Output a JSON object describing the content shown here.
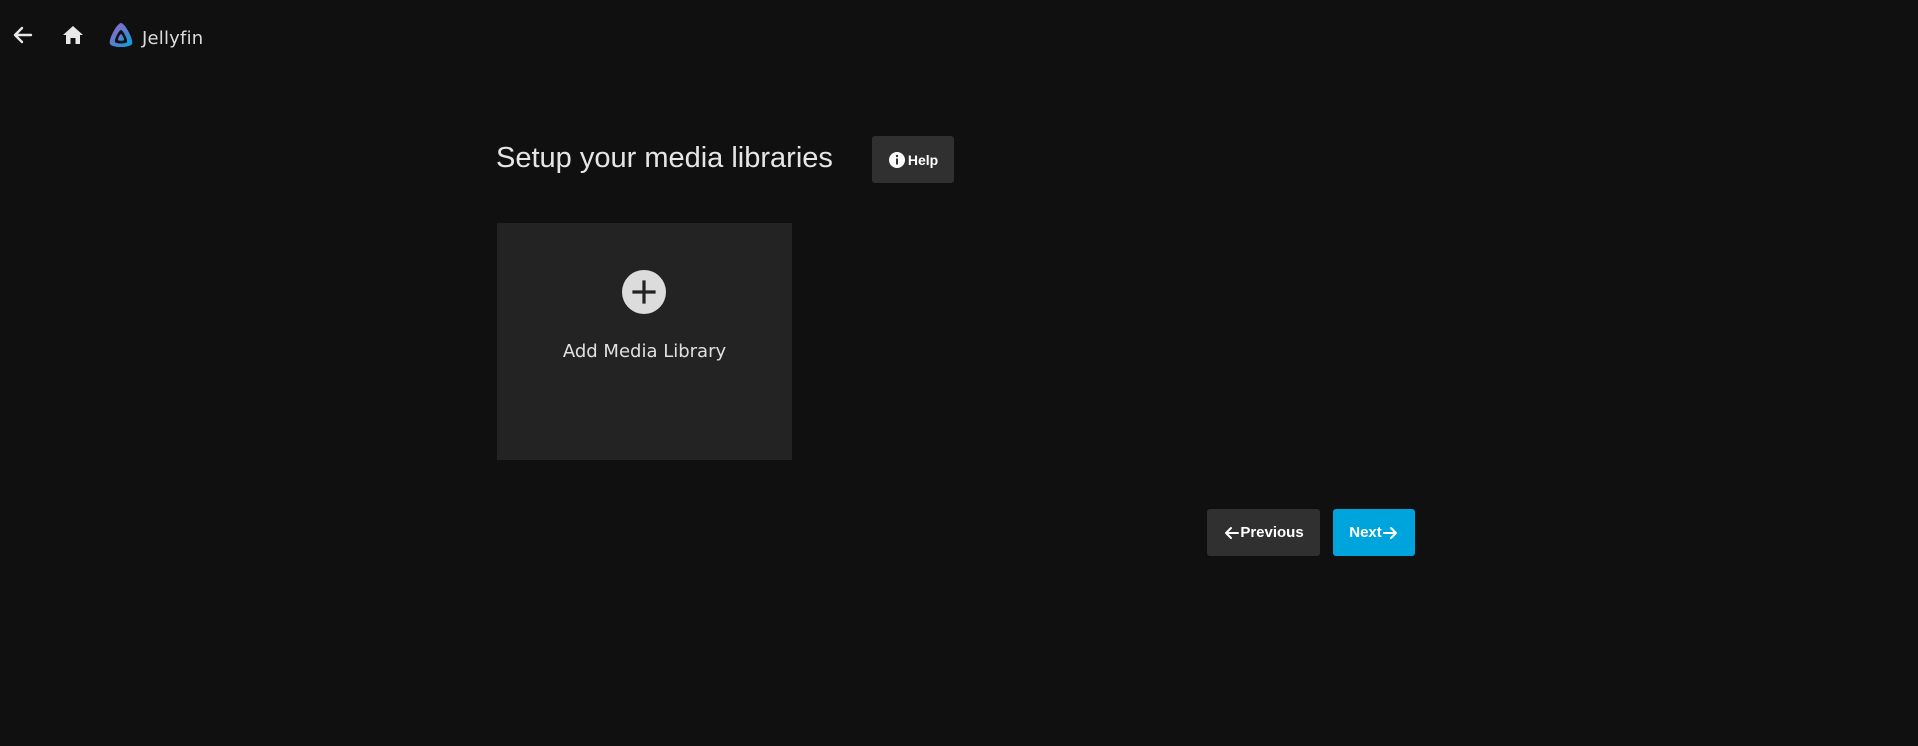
{
  "header": {
    "back_icon": "arrow-left-icon",
    "home_icon": "home-icon",
    "brand_logo": "jellyfin-logo",
    "brand_name": "Jellyfin"
  },
  "main": {
    "title": "Setup your media libraries",
    "help_label": "Help",
    "help_icon": "info-icon",
    "add_library": {
      "icon": "plus-icon",
      "label": "Add Media Library"
    }
  },
  "footer_nav": {
    "previous_label": "Previous",
    "next_label": "Next"
  },
  "colors": {
    "background": "#101010",
    "card": "#232323",
    "button_secondary": "#303030",
    "accent": "#00a4dc"
  }
}
